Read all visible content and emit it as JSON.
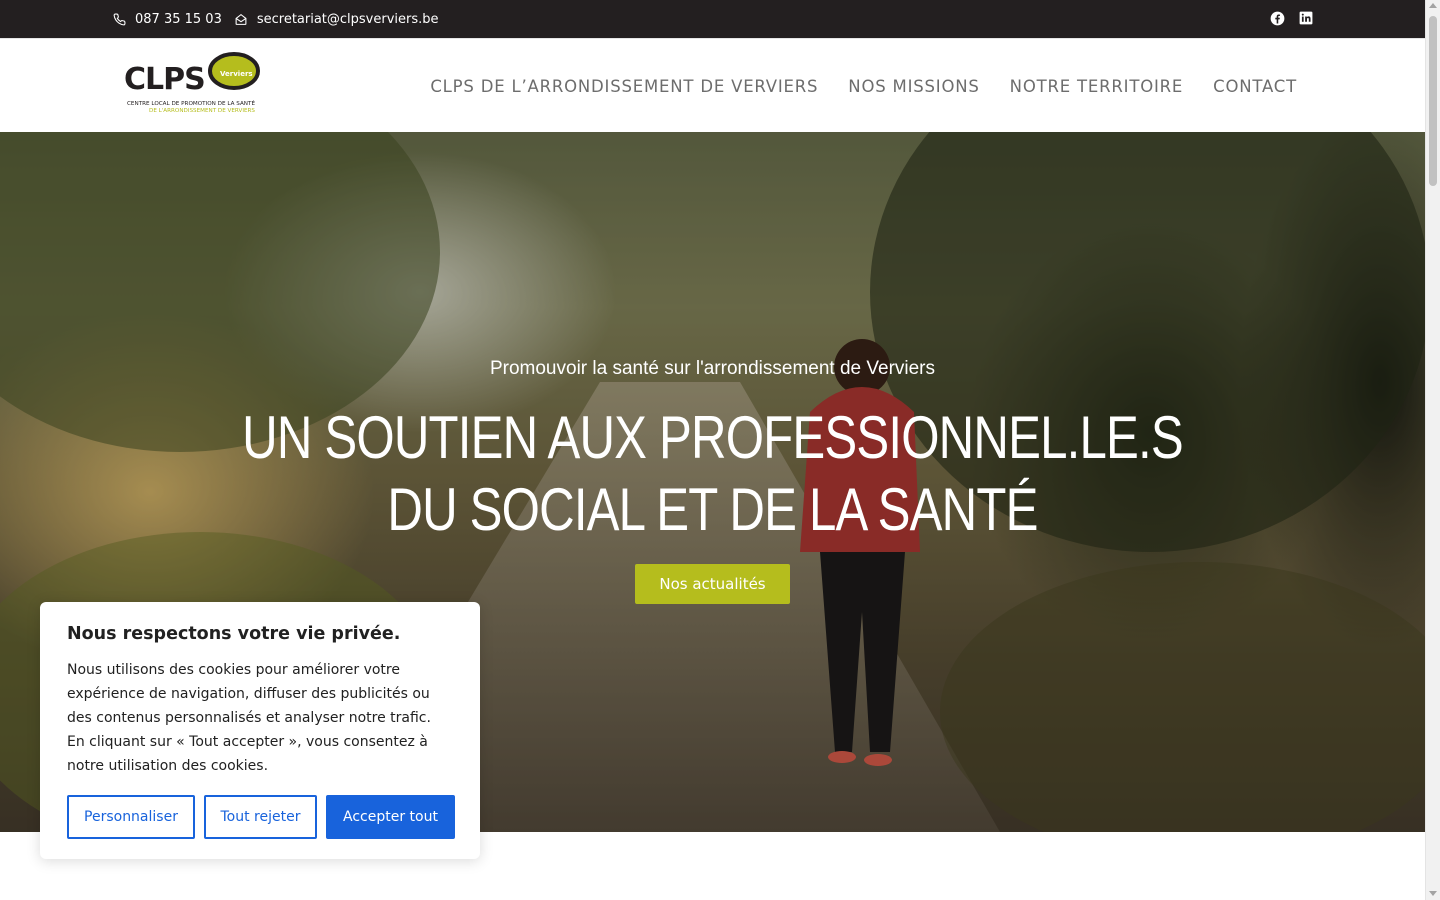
{
  "topbar": {
    "phone": "087 35 15 03",
    "email": "secretariat@clpsverviers.be",
    "social": [
      "facebook-icon",
      "linkedin-icon"
    ]
  },
  "logo": {
    "wordmark": "CLPS",
    "badge": "Verviers",
    "line1": "CENTRE LOCAL DE PROMOTION DE LA SANTÉ",
    "line2": "DE L'ARRONDISSEMENT DE VERVIERS",
    "colors": {
      "accent": "#b5bd1d",
      "text": "#231f20"
    }
  },
  "nav": {
    "items": [
      {
        "label": "CLPS DE L’ARRONDISSEMENT DE VERVIERS"
      },
      {
        "label": "NOS MISSIONS"
      },
      {
        "label": "NOTRE TERRITOIRE"
      },
      {
        "label": "CONTACT"
      }
    ]
  },
  "hero": {
    "subtitle": "Promouvoir la santé sur l'arrondissement de Verviers",
    "title_line1": "UN SOUTIEN AUX PROFESSIONNEL.LE.S",
    "title_line2": "DU SOCIAL ET DE LA SANTÉ",
    "cta": "Nos actualités",
    "cta_color": "#b5bd1d"
  },
  "cookie": {
    "title": "Nous respectons votre vie privée.",
    "text": "Nous utilisons des cookies pour améliorer votre expérience de navigation, diffuser des publicités ou des contenus personnalisés et analyser notre trafic. En cliquant sur « Tout accepter », vous consentez à notre utilisation des cookies.",
    "customize": "Personnaliser",
    "reject": "Tout rejeter",
    "accept": "Accepter tout",
    "button_color": "#1863dc"
  }
}
